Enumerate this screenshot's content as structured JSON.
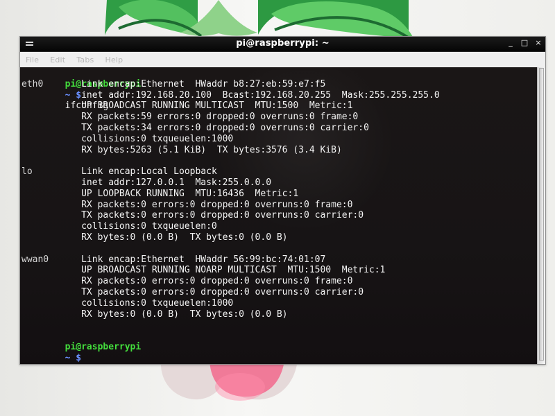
{
  "window": {
    "title": "pi@raspberrypi: ~",
    "controls": [
      "_",
      "□",
      "×"
    ]
  },
  "menubar": {
    "items": [
      "File",
      "Edit",
      "Tabs",
      "Help"
    ]
  },
  "terminal": {
    "prompt": {
      "user_host": "pi@raspberrypi",
      "path_symbol": "~ $",
      "command": "ifconfig"
    },
    "interfaces": [
      {
        "name": "eth0",
        "lines": [
          "Link encap:Ethernet  HWaddr b8:27:eb:59:e7:f5",
          "inet addr:192.168.20.100  Bcast:192.168.20.255  Mask:255.255.255.0",
          "UP BROADCAST RUNNING MULTICAST  MTU:1500  Metric:1",
          "RX packets:59 errors:0 dropped:0 overruns:0 frame:0",
          "TX packets:34 errors:0 dropped:0 overruns:0 carrier:0",
          "collisions:0 txqueuelen:1000",
          "RX bytes:5263 (5.1 KiB)  TX bytes:3576 (3.4 KiB)"
        ]
      },
      {
        "name": "lo",
        "lines": [
          "Link encap:Local Loopback",
          "inet addr:127.0.0.1  Mask:255.0.0.0",
          "UP LOOPBACK RUNNING  MTU:16436  Metric:1",
          "RX packets:0 errors:0 dropped:0 overruns:0 frame:0",
          "TX packets:0 errors:0 dropped:0 overruns:0 carrier:0",
          "collisions:0 txqueuelen:0",
          "RX bytes:0 (0.0 B)  TX bytes:0 (0.0 B)"
        ]
      },
      {
        "name": "wwan0",
        "lines": [
          "Link encap:Ethernet  HWaddr 56:99:bc:74:01:07",
          "UP BROADCAST RUNNING NOARP MULTICAST  MTU:1500  Metric:1",
          "RX packets:0 errors:0 dropped:0 overruns:0 frame:0",
          "TX packets:0 errors:0 dropped:0 overruns:0 carrier:0",
          "collisions:0 txqueuelen:1000",
          "RX bytes:0 (0.0 B)  TX bytes:0 (0.0 B)"
        ]
      }
    ],
    "final_prompt": {
      "user_host": "pi@raspberrypi",
      "path_symbol": "~ $"
    }
  },
  "icons": {
    "window_menu": "window-menu-icon",
    "cursor": "terminal-cursor-icon"
  },
  "colors": {
    "terminal_background": "#1b1616",
    "terminal_text": "#f2f2f2",
    "prompt_user": "#44df3d",
    "prompt_path": "#6a90ff",
    "wallpaper_leaf": "#3ea84f",
    "wallpaper_berry": "#ef7a95"
  }
}
